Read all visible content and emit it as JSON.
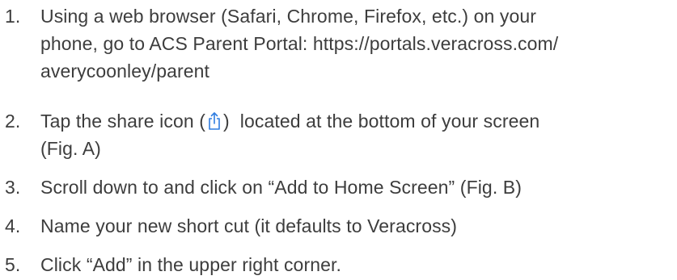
{
  "steps": [
    {
      "number": "1.",
      "lines": [
        "Using a web browser (Safari, Chrome, Firefox, etc.) on your",
        "phone, go to ACS Parent Portal: https://portals.veracross.com/",
        "averycoonley/parent"
      ]
    },
    {
      "number": "2.",
      "line1_before_icon": "Tap the share icon (",
      "icon": "share-icon",
      "line1_after_icon": ")  located at the bottom of your screen",
      "line2": "(Fig. A)"
    },
    {
      "number": "3.",
      "text": "Scroll down to and click on “Add to Home Screen” (Fig. B)"
    },
    {
      "number": "4.",
      "text": "Name your new short cut (it defaults to Veracross)"
    },
    {
      "number": "5.",
      "text": "Click “Add” in the upper right corner."
    }
  ],
  "colors": {
    "text": "#3d3d3d",
    "icon_accent": "#2f7de1",
    "background": "#ffffff"
  }
}
